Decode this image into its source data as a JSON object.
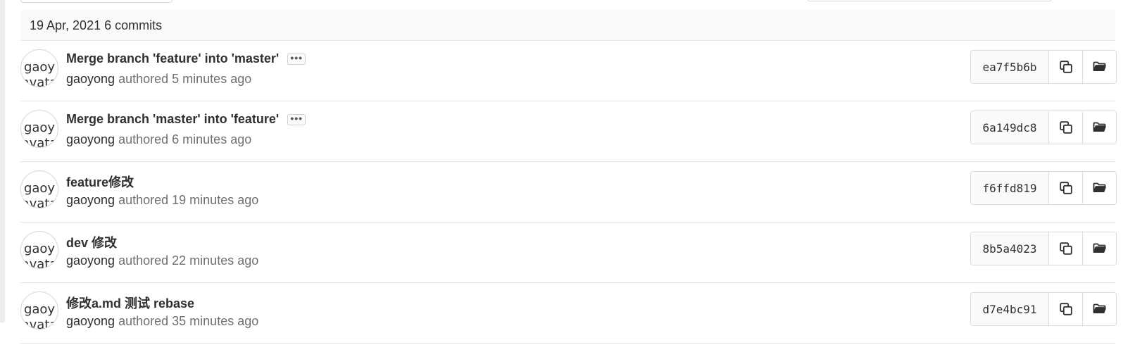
{
  "day": {
    "date": "19 Apr, 2021",
    "count_label": "6 commits"
  },
  "commits": [
    {
      "avatar_alt_line1": "gaoy",
      "avatar_alt_line2": "avata",
      "title": "Merge branch 'feature' into 'master'",
      "has_description_toggle": true,
      "description_toggle_label": "•••",
      "author": "gaoyong",
      "authored_text": "authored 5 minutes ago",
      "sha": "ea7f5b6b"
    },
    {
      "avatar_alt_line1": "gaoy",
      "avatar_alt_line2": "avata",
      "title": "Merge branch 'master' into 'feature'",
      "has_description_toggle": true,
      "description_toggle_label": "•••",
      "author": "gaoyong",
      "authored_text": "authored 6 minutes ago",
      "sha": "6a149dc8"
    },
    {
      "avatar_alt_line1": "gaoy",
      "avatar_alt_line2": "avata",
      "title": "feature修改",
      "has_description_toggle": false,
      "author": "gaoyong",
      "authored_text": "authored 19 minutes ago",
      "sha": "f6ffd819"
    },
    {
      "avatar_alt_line1": "gaoy",
      "avatar_alt_line2": "avata",
      "title": "dev 修改",
      "has_description_toggle": false,
      "author": "gaoyong",
      "authored_text": "authored 22 minutes ago",
      "sha": "8b5a4023"
    },
    {
      "avatar_alt_line1": "gaoy",
      "avatar_alt_line2": "avata",
      "title": "修改a.md 测试 rebase",
      "has_description_toggle": false,
      "author": "gaoyong",
      "authored_text": "authored 35 minutes ago",
      "sha": "d7e4bc91"
    }
  ],
  "icons": {
    "copy": "copy-icon",
    "browse": "folder-open-icon"
  },
  "colors": {
    "text": "#303030",
    "muted": "#707070",
    "border": "#dbdbdb",
    "header_bg": "#fafafa"
  }
}
